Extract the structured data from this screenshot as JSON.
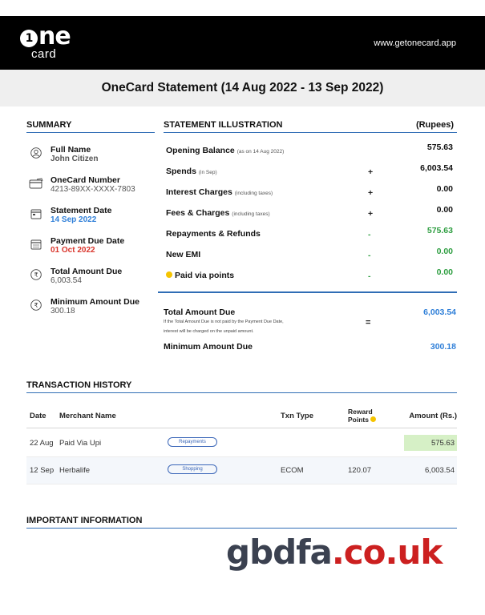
{
  "header": {
    "brand_one": "one",
    "brand_one_mark": "1",
    "brand_card": "card",
    "website": "www.getonecard.app"
  },
  "title": "OneCard Statement (14 Aug 2022 - 13 Sep 2022)",
  "summary": {
    "heading": "SUMMARY",
    "items": [
      {
        "icon": "user-icon",
        "label": "Full Name",
        "value": "John Citizen"
      },
      {
        "icon": "card-icon",
        "label": "OneCard Number",
        "value": "4213-89XX-XXXX-7803"
      },
      {
        "icon": "calendar-icon",
        "label": "Statement Date",
        "value": "14 Sep 2022"
      },
      {
        "icon": "calendar-due-icon",
        "label": "Payment Due Date",
        "value": "01 Oct 2022"
      },
      {
        "icon": "rupee-icon",
        "label": "Total Amount Due",
        "value": "6,003.54"
      },
      {
        "icon": "rupee-icon",
        "label": "Minimum Amount Due",
        "value": "300.18"
      }
    ]
  },
  "illustration": {
    "heading": "STATEMENT ILLUSTRATION",
    "unit": "(Rupees)",
    "rows": [
      {
        "label": "Opening Balance",
        "note": "(as on 14 Aug 2022)",
        "op": "",
        "value": "575.63"
      },
      {
        "label": "Spends",
        "note": "(in Sep)",
        "op": "+",
        "value": "6,003.54"
      },
      {
        "label": "Interest Charges",
        "note": "(including taxes)",
        "op": "+",
        "value": "0.00"
      },
      {
        "label": "Fees & Charges",
        "note": "(including taxes)",
        "op": "+",
        "value": "0.00"
      },
      {
        "label": "Repayments & Refunds",
        "note": "",
        "op": "-",
        "value": "575.63"
      },
      {
        "label": "New EMI",
        "note": "",
        "op": "-",
        "value": "0.00"
      },
      {
        "label": "Paid via points",
        "note": "",
        "op": "-",
        "value": "0.00"
      }
    ],
    "total_due_label": "Total Amount Due",
    "total_due_note_1": "If the Total Amount Due is not paid by the Payment Due Date,",
    "total_due_note_2": "interest will be charged on the unpaid amount.",
    "equals": "=",
    "total_due_value": "6,003.54",
    "min_due_label": "Minimum Amount Due",
    "min_due_value": "300.18"
  },
  "transactions": {
    "heading": "TRANSACTION HISTORY",
    "columns": {
      "date": "Date",
      "merchant": "Merchant Name",
      "type": "Txn Type",
      "reward_1": "Reward",
      "reward_2": "Points",
      "amount": "Amount (Rs.)"
    },
    "rows": [
      {
        "date": "22 Aug",
        "merchant": "Paid Via Upi",
        "category": "Repayments",
        "type": "",
        "points": "",
        "amount": "575.63"
      },
      {
        "date": "12 Sep",
        "merchant": "Herbalife",
        "category": "Shopping",
        "type": "ECOM",
        "points": "120.07",
        "amount": "6,003.54"
      }
    ]
  },
  "important": {
    "heading": "IMPORTANT INFORMATION"
  },
  "watermark": {
    "part1": "gbdfa",
    "part2": ".co.uk"
  },
  "colors": {
    "accent_blue": "#2f7fd8",
    "green": "#2e9e41",
    "red": "#d9342b",
    "header_bg": "#000000"
  }
}
